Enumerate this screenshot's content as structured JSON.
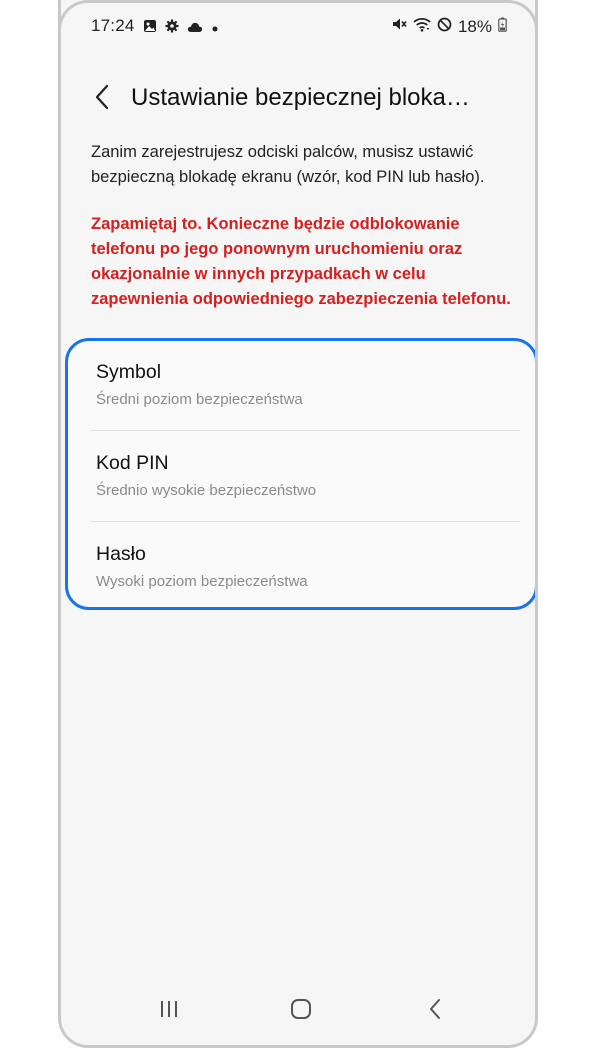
{
  "status_bar": {
    "time": "17:24",
    "battery": "18%",
    "left_icons": [
      "image-icon",
      "gear-icon",
      "cloud-icon",
      "dot-icon"
    ],
    "right_icons": [
      "mute-icon",
      "wifi-icon",
      "do-not-disturb-icon",
      "battery-icon"
    ]
  },
  "header": {
    "title": "Ustawianie bezpiecznej bloka…"
  },
  "intro_text": "Zanim zarejestrujesz odciski palców, musisz ustawić bezpieczną blokadę ekranu (wzór, kod PIN lub hasło).",
  "warning_text": "Zapamiętaj to. Konieczne będzie odblokowanie telefonu po jego ponownym uruchomieniu oraz okazjonalnie w innych przypadkach w celu zapewnienia odpowiedniego zabezpieczenia telefonu.",
  "options": [
    {
      "title": "Symbol",
      "subtitle": "Średni poziom bezpieczeństwa"
    },
    {
      "title": "Kod PIN",
      "subtitle": "Średnio wysokie bezpieczeństwo"
    },
    {
      "title": "Hasło",
      "subtitle": "Wysoki poziom bezpieczeństwa"
    }
  ],
  "colors": {
    "accent": "#1a73e8",
    "warning": "#d32020",
    "background": "#f6f6f6"
  },
  "navigation": {
    "icons": [
      "recent-apps-icon",
      "home-icon",
      "back-icon"
    ]
  }
}
